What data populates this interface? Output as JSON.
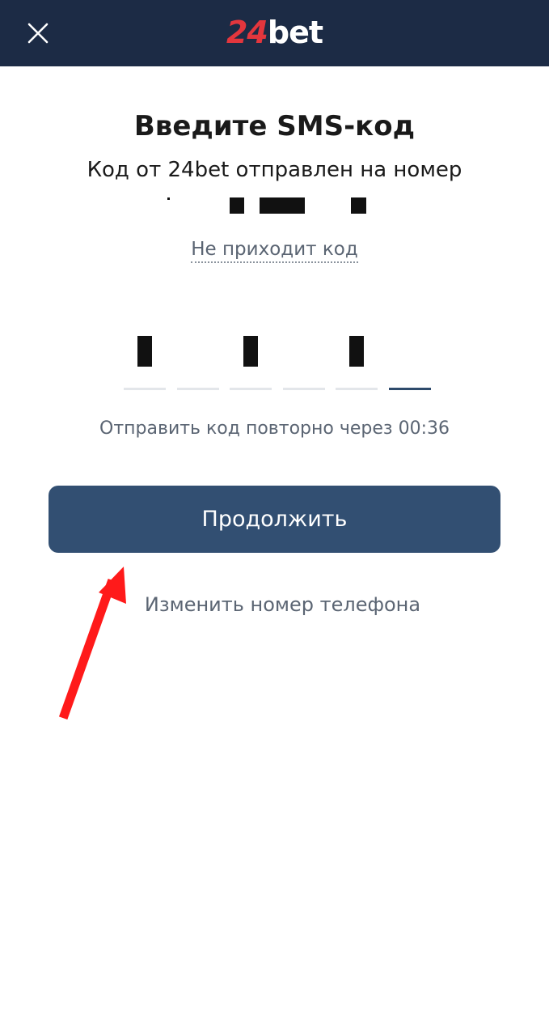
{
  "header": {
    "close_icon": "close-icon",
    "logo": {
      "number": "24",
      "word": "bet"
    }
  },
  "title": "Введите SMS-код",
  "subtitle": "Код от 24bet отправлен на номер",
  "links": {
    "no_code": "Не приходит код"
  },
  "code": {
    "slot_count": 6,
    "filled_slots": [
      0,
      2,
      4
    ],
    "active_slot": 5
  },
  "resend_text": "Отправить код повторно через 00:36",
  "continue_button": "Продолжить",
  "change_phone": "Изменить номер телефона",
  "colors": {
    "header_bg": "#1c2b45",
    "logo_red": "#e3363d",
    "button_bg": "#324f72",
    "annotation_arrow": "#ff1a1a"
  }
}
